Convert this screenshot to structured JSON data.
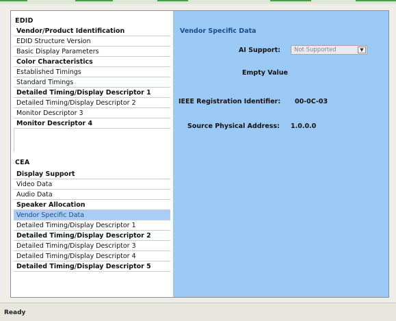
{
  "colors": {
    "detail_panel_bg": "#9ac9f5",
    "selected_item_bg": "#a9cdf4",
    "accent_text": "#1a4c8c",
    "top_accent": "#3ea346"
  },
  "sidebar": {
    "edid_header": "EDID",
    "edid_items": [
      "Vendor/Product Identification",
      "EDID Structure Version",
      "Basic Display Parameters",
      "Color Characteristics",
      "Established Timings",
      "Standard Timings",
      "Detailed Timing/Display Descriptor 1",
      "Detailed Timing/Display Descriptor 2",
      "Monitor Descriptor 3",
      "Monitor Descriptor 4"
    ],
    "cea_header": "CEA",
    "cea_items": [
      "Display Support",
      "Video Data",
      "Audio Data",
      "Speaker Allocation",
      "Vendor Specific Data",
      "Detailed Timing/Display Descriptor 1",
      "Detailed Timing/Display Descriptor 2",
      "Detailed Timing/Display Descriptor 3",
      "Detailed Timing/Display Descriptor 4",
      "Detailed Timing/Display Descriptor 5"
    ]
  },
  "detail": {
    "title": "Vendor Specific Data",
    "audio_support_label": "AI Support:",
    "audio_support_value": "Not Supported",
    "empty_value_label": "Empty Value",
    "ieee_label": "IEEE Registration Identifier:",
    "ieee_value": "00-0C-03",
    "source_label": "Source Physical Address:",
    "source_value": "1.0.0.0"
  },
  "status": {
    "text": "Ready"
  }
}
